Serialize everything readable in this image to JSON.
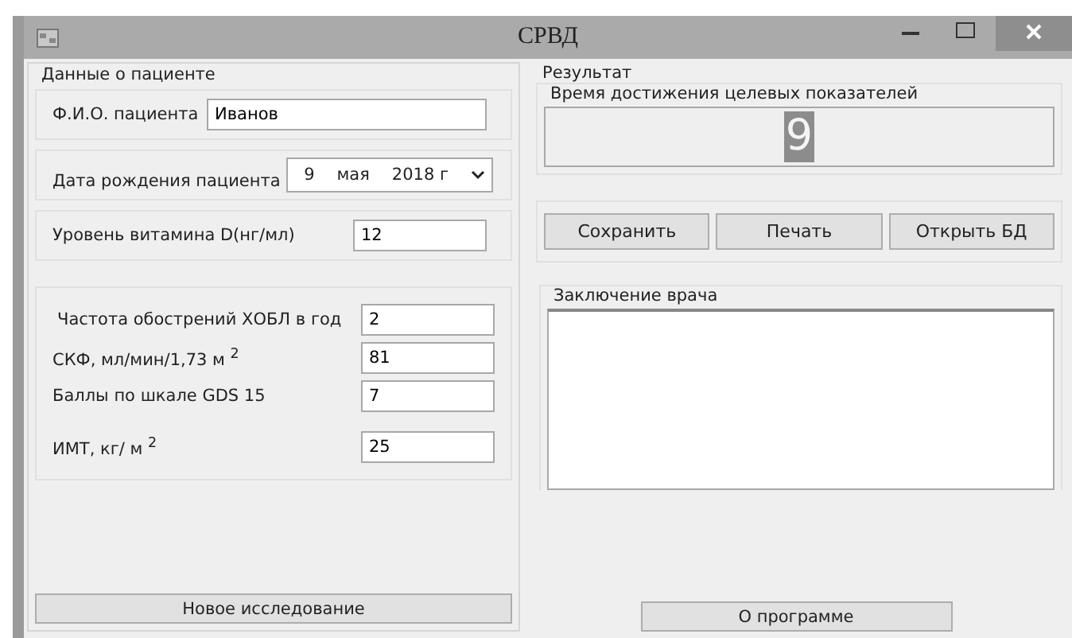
{
  "window": {
    "title": "СРВД"
  },
  "patient": {
    "title": "Данные о пациенте",
    "name": {
      "label": "Ф.И.О. пациента",
      "value": "Иванов"
    },
    "birth": {
      "label": "Дата рождения пациента",
      "day": "9",
      "month": "мая",
      "year": "2018 г"
    },
    "vitamin": {
      "label": "Уровень витамина D(нг/мл)",
      "value": "12"
    },
    "params": [
      {
        "label": "Частота обострений ХОБЛ в год",
        "value": "2"
      },
      {
        "label": "СКФ, мл/мин/1,73 м $^{2}$",
        "value": "81"
      },
      {
        "label": "Баллы по шкале GDS 15",
        "value": "7"
      },
      {
        "label": "ИМТ, кг/ м $^{2}$",
        "value": "25"
      }
    ],
    "new_button": "Новое исследование"
  },
  "result": {
    "title": "Результат",
    "time_title": "Время достижения целевых показателей",
    "time_value": "9",
    "buttons": [
      "Сохранить",
      "Печать",
      "Открыть БД"
    ],
    "conclusion_title": "Заключение врача",
    "about_button": "О программе"
  }
}
